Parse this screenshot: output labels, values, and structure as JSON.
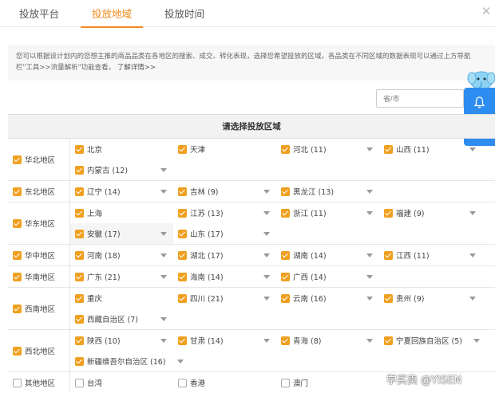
{
  "tabs": [
    "投放平台",
    "投放地域",
    "投放时间"
  ],
  "notice": {
    "text": "您可以根据设计划内的您想主推的商品品类在各地区的搜索、成交、转化表现，选择您希望投放的区域。各品类在不同区域的数据表现可以通过上方导航栏\"工具>>流量解析\"功能查看，",
    "link": "了解详情>>"
  },
  "search": {
    "placeholder": "省/市"
  },
  "table": {
    "header": "请选择投放区域",
    "regions": [
      {
        "name": "华北地区",
        "checked": true,
        "provinces": [
          {
            "label": "北京",
            "checked": true
          },
          {
            "label": "天津",
            "checked": true
          },
          {
            "label": "河北 (11)",
            "checked": true,
            "dropdown": true
          },
          {
            "label": "山西 (11)",
            "checked": true,
            "dropdown": true
          },
          {
            "label": "内蒙古 (12)",
            "checked": true,
            "dropdown": true
          }
        ]
      },
      {
        "name": "东北地区",
        "checked": true,
        "provinces": [
          {
            "label": "辽宁 (14)",
            "checked": true,
            "dropdown": true
          },
          {
            "label": "吉林 (9)",
            "checked": true,
            "dropdown": true
          },
          {
            "label": "黑龙江 (13)",
            "checked": true,
            "dropdown": true
          }
        ]
      },
      {
        "name": "华东地区",
        "checked": true,
        "provinces": [
          {
            "label": "上海",
            "checked": true
          },
          {
            "label": "江苏 (13)",
            "checked": true,
            "dropdown": true
          },
          {
            "label": "浙江 (11)",
            "checked": true,
            "dropdown": true
          },
          {
            "label": "福建 (9)",
            "checked": true,
            "dropdown": true
          },
          {
            "label": "安徽 (17)",
            "checked": true,
            "dropdown": true,
            "dim": true
          },
          {
            "label": "山东 (17)",
            "checked": true,
            "dropdown": true
          }
        ]
      },
      {
        "name": "华中地区",
        "checked": true,
        "provinces": [
          {
            "label": "河南 (18)",
            "checked": true,
            "dropdown": true
          },
          {
            "label": "湖北 (17)",
            "checked": true,
            "dropdown": true
          },
          {
            "label": "湖南 (14)",
            "checked": true,
            "dropdown": true
          },
          {
            "label": "江西 (11)",
            "checked": true,
            "dropdown": true
          }
        ]
      },
      {
        "name": "华南地区",
        "checked": true,
        "provinces": [
          {
            "label": "广东 (21)",
            "checked": true,
            "dropdown": true
          },
          {
            "label": "海南 (14)",
            "checked": true,
            "dropdown": true
          },
          {
            "label": "广西 (14)",
            "checked": true,
            "dropdown": true
          }
        ]
      },
      {
        "name": "西南地区",
        "checked": true,
        "provinces": [
          {
            "label": "重庆",
            "checked": true
          },
          {
            "label": "四川 (21)",
            "checked": true,
            "dropdown": true
          },
          {
            "label": "云南 (16)",
            "checked": true,
            "dropdown": true
          },
          {
            "label": "贵州 (9)",
            "checked": true,
            "dropdown": true
          },
          {
            "label": "西藏自治区 (7)",
            "checked": true,
            "dropdown": true
          }
        ]
      },
      {
        "name": "西北地区",
        "checked": true,
        "provinces": [
          {
            "label": "陕西 (10)",
            "checked": true,
            "dropdown": true
          },
          {
            "label": "甘肃 (14)",
            "checked": true,
            "dropdown": true
          },
          {
            "label": "青海 (8)",
            "checked": true,
            "dropdown": true
          },
          {
            "label": "宁夏回族自治区 (5)",
            "checked": true,
            "dropdown": true,
            "caret_right": true
          },
          {
            "label": "新疆维吾尔自治区 (16)",
            "checked": true,
            "dropdown": true,
            "wide": true
          }
        ]
      },
      {
        "name": "其他地区",
        "checked": false,
        "provinces": [
          {
            "label": "台湾",
            "checked": false
          },
          {
            "label": "香港",
            "checked": false
          },
          {
            "label": "澳门",
            "checked": false
          }
        ]
      }
    ]
  },
  "watermark": "学买卖 @YISEN",
  "colors": {
    "accent": "#f08a1c",
    "checkbox": "#f0a020",
    "float_panel": "#2d8cf0"
  },
  "icons": {
    "close": "close-icon",
    "bell": "bell-icon",
    "message": "message-icon",
    "mascot": "elephant-mascot-icon"
  }
}
